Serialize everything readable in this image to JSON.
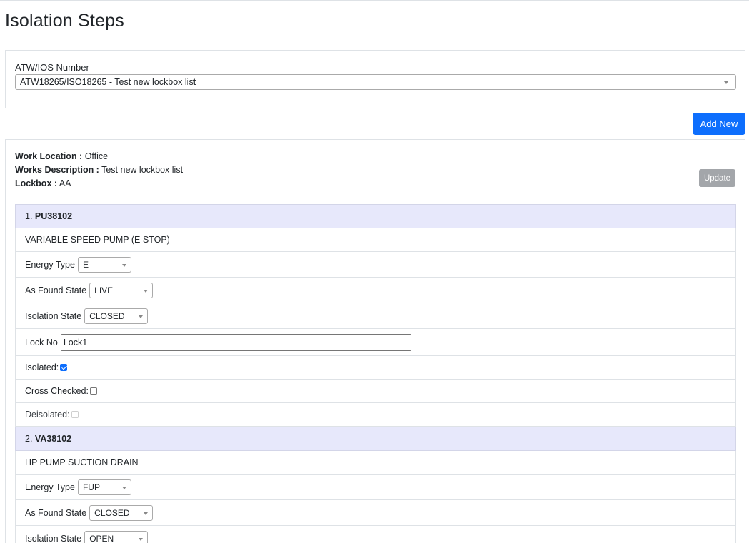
{
  "page_title": "Isolation Steps",
  "selector": {
    "label": "ATW/IOS Number",
    "value": "ATW18265/ISO18265 - Test new lockbox list"
  },
  "add_new_label": "Add New",
  "info": {
    "work_location_label": "Work Location :",
    "work_location_value": "Office",
    "works_description_label": "Works Description :",
    "works_description_value": "Test new lockbox list",
    "lockbox_label": "Lockbox :",
    "lockbox_value": "AA"
  },
  "update_label": "Update",
  "fields": {
    "energy_type": "Energy Type",
    "as_found_state": "As Found State",
    "isolation_state": "Isolation State",
    "lock_no": "Lock No",
    "isolated": "Isolated:",
    "cross_checked": "Cross Checked:",
    "deisolated": "Deisolated:"
  },
  "steps": [
    {
      "number": "1.",
      "code": "PU38102",
      "description": "VARIABLE SPEED PUMP (E STOP)",
      "energy_type": "E",
      "as_found_state": "LIVE",
      "isolation_state": "CLOSED",
      "lock_no": "Lock1",
      "isolated": true,
      "cross_checked": false,
      "deisolated": false
    },
    {
      "number": "2.",
      "code": "VA38102",
      "description": "HP PUMP SUCTION DRAIN",
      "energy_type": "FUP",
      "as_found_state": "CLOSED",
      "isolation_state": "OPEN"
    }
  ]
}
